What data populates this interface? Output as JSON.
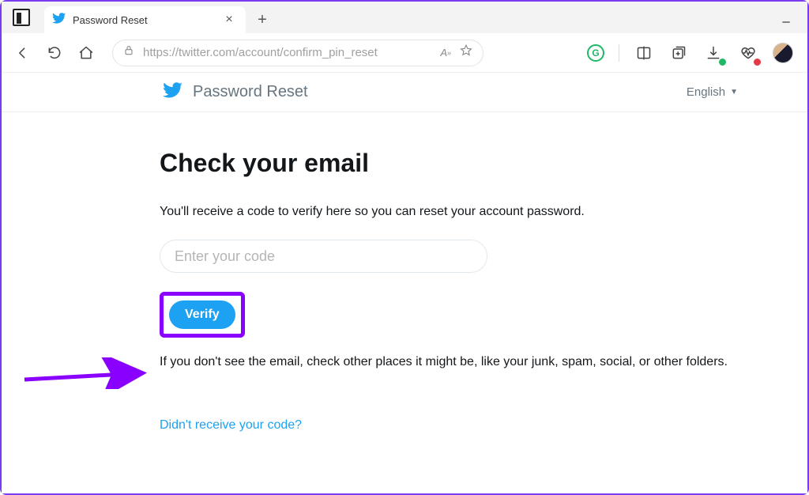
{
  "browser": {
    "tab_title": "Password Reset",
    "url": "https://twitter.com/account/confirm_pin_reset",
    "reader_label": "A",
    "new_tab_label": "+"
  },
  "page_header": {
    "title": "Password Reset",
    "language": "English"
  },
  "main": {
    "heading": "Check your email",
    "lead": "You'll receive a code to verify here so you can reset your account password.",
    "code_placeholder": "Enter your code",
    "verify_label": "Verify",
    "note": "If you don't see the email, check other places it might be, like your junk, spam, social, or other folders.",
    "resend_label": "Didn't receive your code?"
  },
  "icons": {
    "grammarly_letter": "G"
  },
  "annotations": {
    "highlight_color": "#8a00ff",
    "arrow_color": "#8a00ff"
  }
}
